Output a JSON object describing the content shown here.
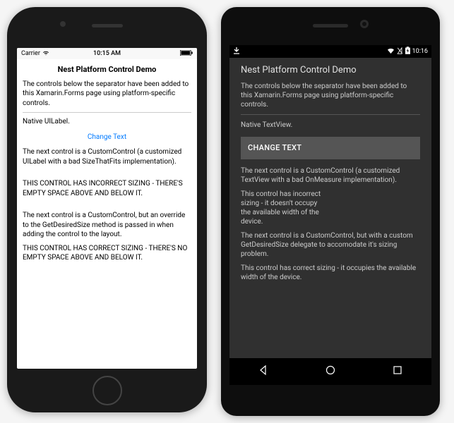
{
  "ios": {
    "status": {
      "carrier": "Carrier",
      "time": "10:15 AM"
    },
    "title": "Nest Platform Control Demo",
    "intro": "The controls below the separator have been added to this Xamarin.Forms page using platform-specific controls.",
    "native_label": "Native UILabel.",
    "change_text": "Change Text",
    "para1": "The next control is a CustomControl (a customized UILabel with a bad SizeThatFits implementation).",
    "caps1": "THIS CONTROL HAS INCORRECT SIZING - THERE'S EMPTY SPACE ABOVE AND BELOW IT.",
    "para2": "The next control is a CustomControl, but an override to the GetDesiredSize method is passed in when adding the control to the layout.",
    "caps2": "THIS CONTROL HAS CORRECT SIZING - THERE'S NO EMPTY SPACE ABOVE AND BELOW IT."
  },
  "android": {
    "status": {
      "time": "10:16"
    },
    "title": "Nest Platform Control Demo",
    "intro": "The controls below the separator have been added to this Xamarin.Forms page using platform-specific controls.",
    "native_label": "Native TextView.",
    "change_text": "CHANGE TEXT",
    "para1": "The next control is a CustomControl (a customized TextView with a bad OnMeasure implementation).",
    "para2": "This control has incorrect sizing - it doesn't occupy the available width of the device.",
    "para3": "The next control is a CustomControl, but with a custom GetDesiredSize delegate to accomodate it's sizing problem.",
    "para4": "This control has correct sizing - it occupies the available width of the device."
  }
}
